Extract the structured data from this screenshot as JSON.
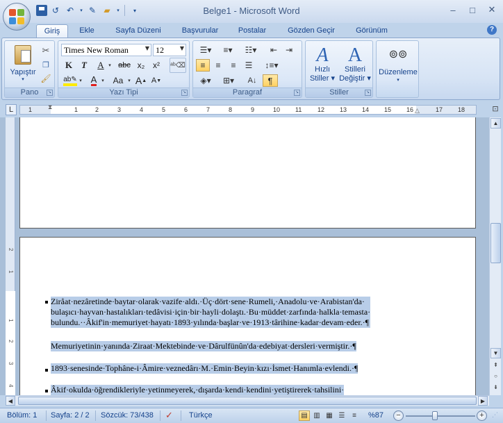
{
  "window": {
    "title": "Belge1 - Microsoft Word",
    "controls": [
      "–",
      "□",
      "✕"
    ]
  },
  "qat": {
    "icons": [
      "save-icon",
      "repeat-icon",
      "undo-icon",
      "new-doc-icon",
      "open-icon",
      "customize-icon"
    ]
  },
  "tabs": [
    {
      "label": "Giriş",
      "active": true
    },
    {
      "label": "Ekle"
    },
    {
      "label": "Sayfa Düzeni"
    },
    {
      "label": "Başvurular"
    },
    {
      "label": "Postalar"
    },
    {
      "label": "Gözden Geçir"
    },
    {
      "label": "Görünüm"
    }
  ],
  "ribbon": {
    "clipboard": {
      "label": "Pano",
      "paste": "Yapıştır"
    },
    "font": {
      "label": "Yazı Tipi",
      "font_name": "Times New Roman",
      "font_size": "12",
      "bold": "K",
      "italic": "T",
      "underline": "A",
      "strike": "abc",
      "sub": "x₂",
      "sup": "x²",
      "grow": "A",
      "shrink": "A",
      "case": "Aa"
    },
    "paragraph": {
      "label": "Paragraf"
    },
    "styles": {
      "label": "Stiller",
      "quick_styles_1": "Hızlı",
      "quick_styles_2": "Stiller",
      "change_styles_1": "Stilleri",
      "change_styles_2": "Değiştir"
    },
    "editing": {
      "label": "Düzenleme"
    }
  },
  "ruler": {
    "numbers": [
      "1",
      "2",
      "1",
      "2",
      "3",
      "4",
      "5",
      "6",
      "7",
      "8",
      "9",
      "10",
      "11",
      "12",
      "13",
      "14",
      "15",
      "16",
      "17",
      "18"
    ]
  },
  "document": {
    "paragraphs": [
      {
        "lines": [
          "Ziråat·nezâretinde·baytar·olarak·vazife·aldı.·Üç·dört·sene·Rumeli,·Anadolu·ve·Arabistan'da·",
          "bulaşıcı·hayvan·hastalıkları·tedâvisi·için·bir·hayli·dolaştı.·Bu·müddet·zarfında·halkla·temasta·",
          "bulundu.··Âkif'in·memuriyet·hayatı·1893·yılında·başlar·ve·1913·târihine·kadar·devam·eder.·¶"
        ]
      },
      {
        "lines": [
          "Memuriyetinin·yanında·Ziraat·Mektebinde·ve·Dârulfünûn'da·edebiyat·dersleri·vermiştir.·¶"
        ]
      },
      {
        "lines": [
          "1893·senesinde·Tophâne-i·Âmire·veznedârı·M.·Emin·Beyin·kızı·İsmet·Hanımla·evlendi.·¶"
        ]
      },
      {
        "lines": [
          "Âkif·okulda·öğrendikleriyle·yetinmeyerek,·dışarda·kendi·kendini·yetiştirerek·tahsilini·"
        ]
      }
    ]
  },
  "statusbar": {
    "section": "Bölüm: 1",
    "page": "Sayfa: 2 / 2",
    "words": "Sözcük: 73/438",
    "language": "Türkçe",
    "zoom": "%87",
    "zoom_level_percent": 87
  }
}
